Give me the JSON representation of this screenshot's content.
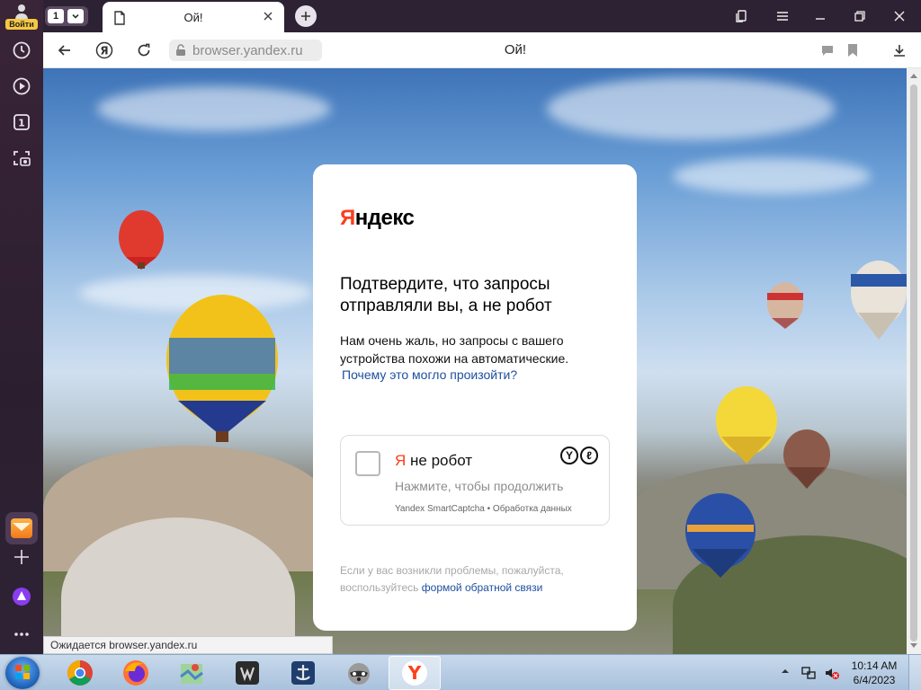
{
  "side_panel": {
    "login_label": "Войти",
    "tab_count_badge": "1",
    "icons": [
      "clock-icon",
      "play-icon",
      "tabs-counter-icon",
      "screenshot-icon",
      "mail-icon",
      "plus-icon",
      "alice-icon",
      "more-icon"
    ]
  },
  "tabstrip": {
    "tab_counter": "1",
    "active_tab_title": "Ой!"
  },
  "navbar": {
    "url": "browser.yandex.ru",
    "page_title": "Ой!"
  },
  "card": {
    "logo_first": "Я",
    "logo_rest": "ндекс",
    "heading": "Подтвердите, что запросы отправляли вы, а не робот",
    "description": "Нам очень жаль, но запросы с вашего устройства похожи на автоматические.",
    "why_link": "Почему это могло произойти?",
    "captcha": {
      "label_first": "Я",
      "label_rest": " не робот",
      "hint": "Нажмите, чтобы продолжить",
      "footer": "Yandex SmartCaptcha • Обработка данных",
      "mark_1": "Y",
      "mark_2": "ℓ"
    },
    "problems_text": "Если у вас возникли проблемы, пожалуйста, воспользуйтесь",
    "feedback_link": "формой обратной связи"
  },
  "status_bar": "Ожидается browser.yandex.ru",
  "taskbar": {
    "apps": [
      "chrome",
      "firefox",
      "maps",
      "world-of-tanks",
      "world-of-warships",
      "raccoon",
      "yandex-browser"
    ],
    "clock_time": "10:14 AM",
    "clock_date": "6/4/2023"
  },
  "colors": {
    "yandex_red": "#fc3f1d",
    "link_blue": "#1e4fa0"
  }
}
